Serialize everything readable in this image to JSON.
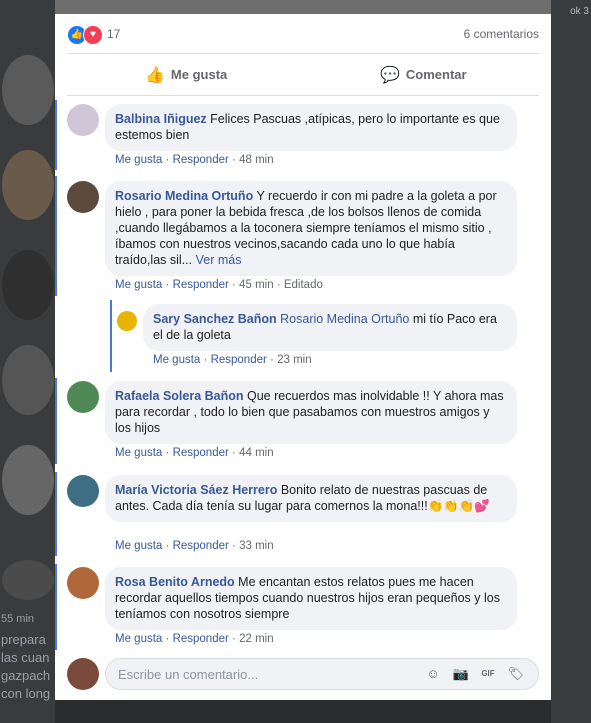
{
  "background": {
    "corner_text": "ok 3",
    "left_snippets": [
      "55 min",
      "prepara",
      "las cuan",
      "gazpach",
      "con long"
    ]
  },
  "post_stats": {
    "reactions": [
      {
        "icon": "like-icon",
        "glyph": "👍"
      },
      {
        "icon": "love-icon",
        "glyph": "♥"
      }
    ],
    "reaction_count": "17",
    "comments_label": "6 comentarios"
  },
  "actions": {
    "like": "Me gusta",
    "like_icon": "👍",
    "comment": "Comentar",
    "comment_icon": "💬"
  },
  "comment_meta": {
    "like": "Me gusta",
    "reply": "Responder",
    "edited": "Editado",
    "sep": "·"
  },
  "comments": [
    {
      "author": "Balbina Iñiguez",
      "text": "Felices Pascuas ,atípicas, pero lo importante es que estemos bien",
      "time": "48 min"
    },
    {
      "author": "Rosario Medina Ortuño",
      "text": "Y recuerdo ir con mi padre a la goleta a por hielo , para poner la bebida fresca ,de los bolsos llenos de comida ,cuando llegábamos a la toconera siempre teníamos el mismo sitio , íbamos con nuestros vecinos,sacando cada uno lo que había traído,las sil...",
      "more": "Ver más",
      "time": "45 min",
      "edited": "Editado",
      "reply": {
        "author": "Sary Sanchez Bañon",
        "mention": "Rosario Medina Ortuño",
        "text": "mi tío Paco era el de la goleta",
        "time": "23 min"
      }
    },
    {
      "author": "Rafaela Solera Bañon",
      "text": "Que recuerdos mas inolvidable !! Y ahora mas para recordar , todo lo bien que pasabamos con muestros amigos y los hijos",
      "time": "44 min"
    },
    {
      "author": "María Victoria Sáez Herrero",
      "text": "Bonito relato de nuestras pascuas de antes. Cada día tenía su lugar para comernos la mona!!!👏👏👏💕",
      "time": "33 min"
    },
    {
      "author": "Rosa Benito Arnedo",
      "text": "Me encantan estos relatos pues me hacen recordar aquellos tiempos cuando nuestros hijos eran pequeños y los teníamos con nosotros siempre",
      "time": "22 min"
    }
  ],
  "composer": {
    "placeholder": "Escribe un comentario...",
    "icons": [
      {
        "name": "emoji-icon",
        "glyph": "☺"
      },
      {
        "name": "camera-icon",
        "glyph": "📷"
      },
      {
        "name": "gif-icon",
        "glyph": "GIF"
      },
      {
        "name": "sticker-icon",
        "glyph": "🏷"
      }
    ]
  },
  "colors": {
    "link": "#385898",
    "bubble": "#f0f2f5",
    "thread_line": "#4a7bd0",
    "like_blue": "#1877f2",
    "love_red": "#f33e58"
  }
}
